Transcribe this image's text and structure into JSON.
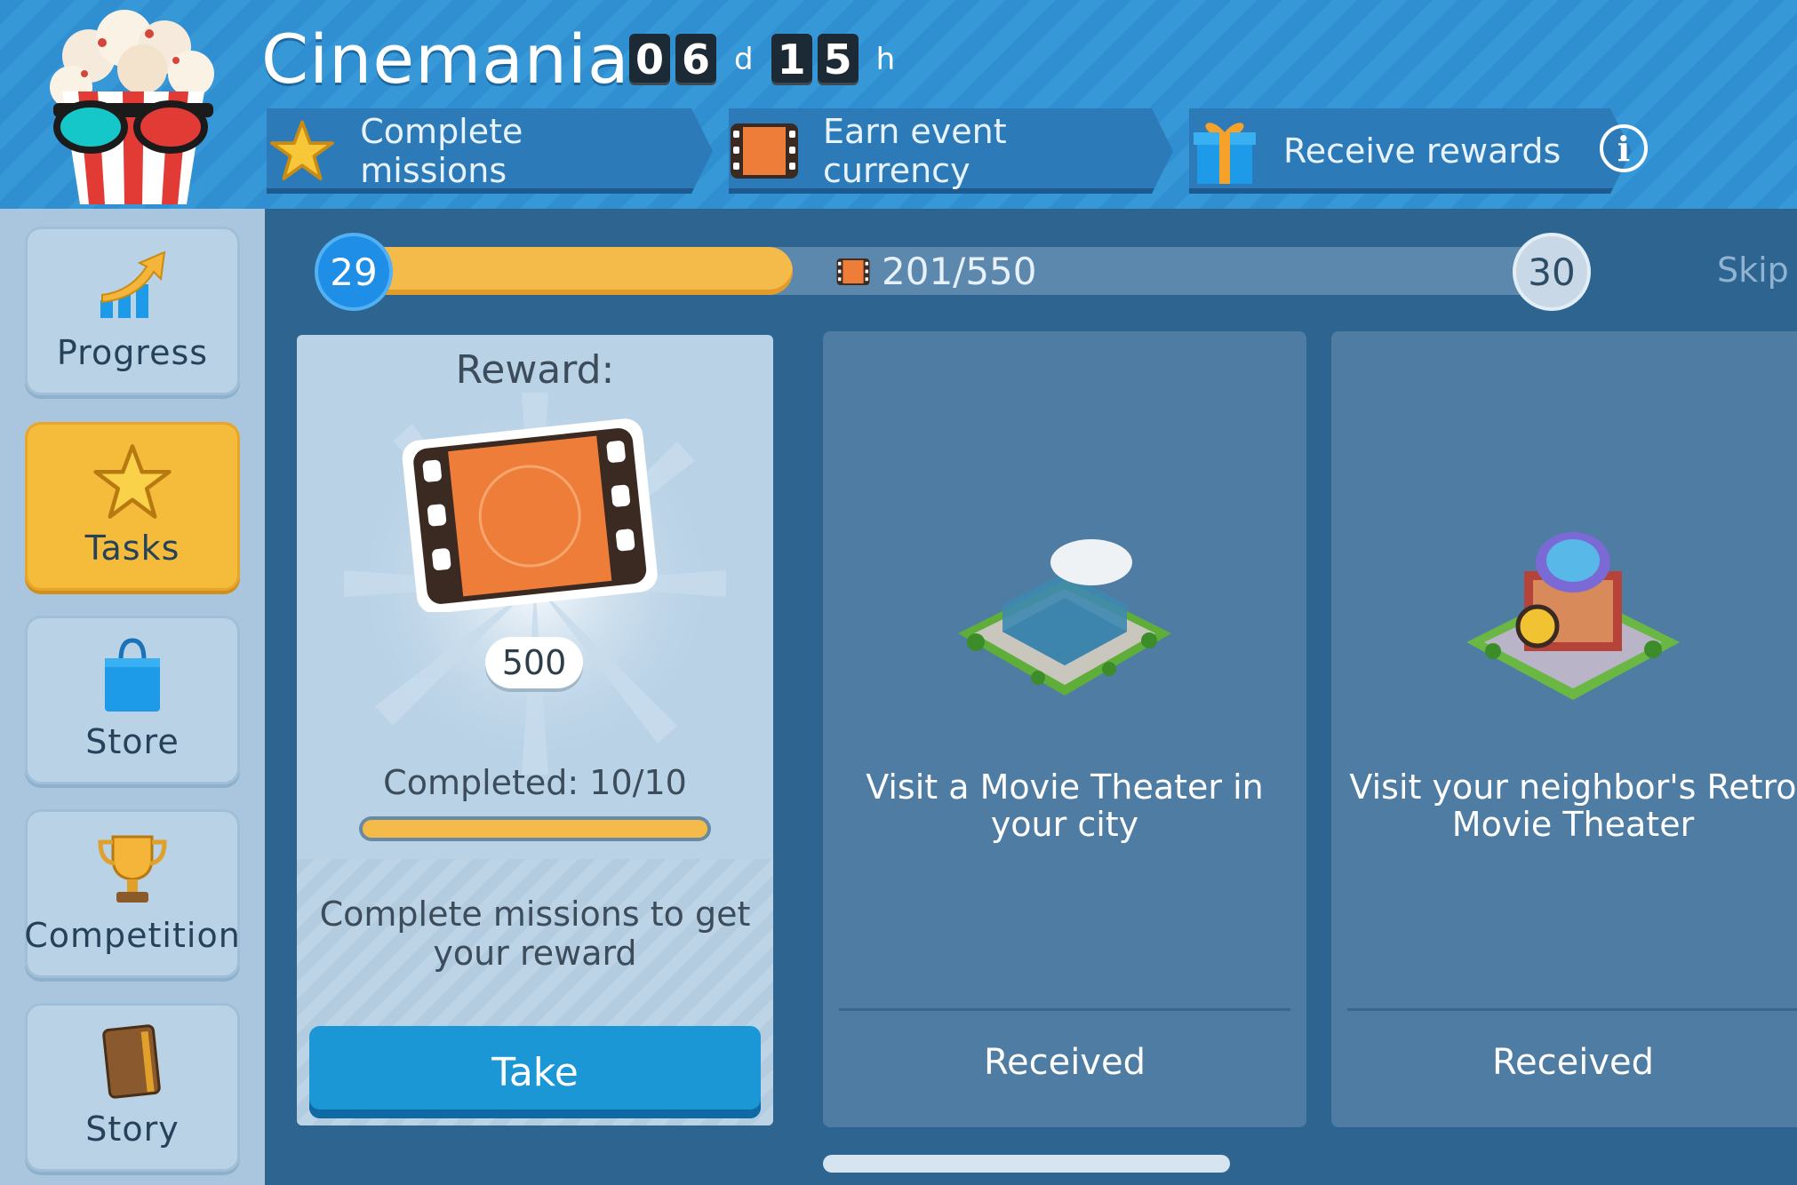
{
  "header": {
    "title": "Cinemania",
    "timer": {
      "days": [
        "0",
        "6"
      ],
      "days_unit": "d",
      "hours": [
        "1",
        "5"
      ],
      "hours_unit": "h"
    },
    "steps": [
      {
        "label": "Complete missions",
        "icon": "star-icon"
      },
      {
        "label": "Earn event currency",
        "icon": "film-frame-icon"
      },
      {
        "label": "Receive rewards",
        "icon": "gift-icon"
      }
    ],
    "info": "i"
  },
  "sidebar": {
    "items": [
      {
        "label": "Progress",
        "icon": "progress-arrow-icon",
        "active": false
      },
      {
        "label": "Tasks",
        "icon": "star-icon",
        "active": true
      },
      {
        "label": "Store",
        "icon": "shopping-bag-icon",
        "active": false
      },
      {
        "label": "Competition",
        "icon": "trophy-icon",
        "active": false
      },
      {
        "label": "Story",
        "icon": "book-icon",
        "active": false
      }
    ]
  },
  "progress": {
    "current_level": "29",
    "next_level": "30",
    "text": "201/550",
    "value": 201,
    "max": 550,
    "skip": "Skip l"
  },
  "reward_card": {
    "title": "Reward:",
    "amount": "500",
    "completed": "Completed: 10/10",
    "completed_fraction": 1.0,
    "hint": "Complete missions to get your reward",
    "button": "Take"
  },
  "tasks": [
    {
      "text": "Visit a Movie Theater in your city",
      "status": "Received",
      "icon": "movie-theater-building-icon"
    },
    {
      "text": "Visit your neighbor's Retro Movie Theater",
      "status": "Received",
      "icon": "retro-theater-building-icon"
    }
  ],
  "colors": {
    "accent_yellow": "#f5bb3a",
    "header_blue": "#2f8fd0",
    "button_blue": "#1b97d6",
    "panel_blue": "#2d6590"
  }
}
